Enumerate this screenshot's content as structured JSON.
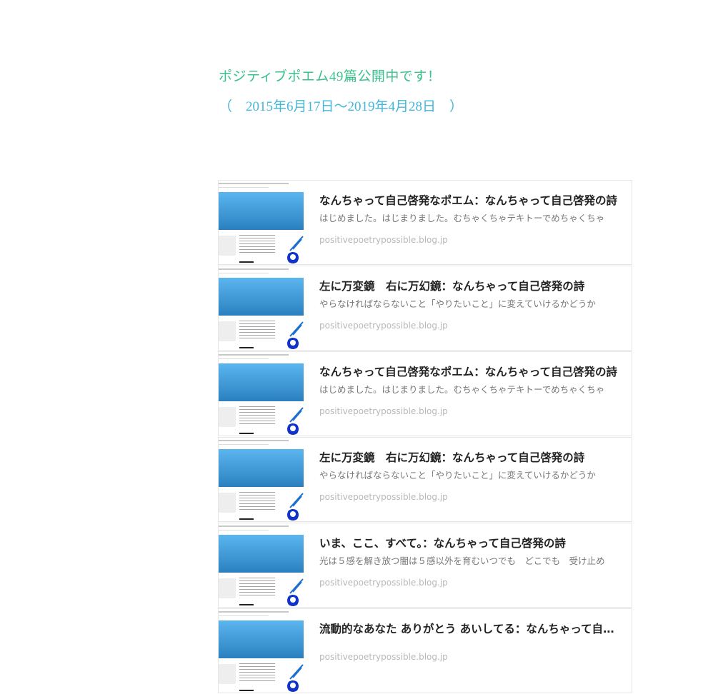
{
  "header": {
    "line1": "ポジティブポエム49篇公開中です！",
    "line2": "（　2015年6月17日～2019年4月28日　）"
  },
  "cards": [
    {
      "title": "なんちゃって自己啓発なポエム：なんちゃって自己啓発の詩",
      "excerpt": "はじめました。はじまりました。むちゃくちゃテキトーでめちゃくちゃ",
      "domain": "positivepoetrypossible.blog.jp"
    },
    {
      "title": "左に万変鏡　右に万幻鏡：なんちゃって自己啓発の詩",
      "excerpt": "やらなければならないこと「やりたいこと」に変えていけるかどうか",
      "domain": "positivepoetrypossible.blog.jp"
    },
    {
      "title": "なんちゃって自己啓発なポエム：なんちゃって自己啓発の詩",
      "excerpt": "はじめました。はじまりました。むちゃくちゃテキトーでめちゃくちゃ",
      "domain": "positivepoetrypossible.blog.jp"
    },
    {
      "title": "左に万変鏡　右に万幻鏡：なんちゃって自己啓発の詩",
      "excerpt": "やらなければならないこと「やりたいこと」に変えていけるかどうか",
      "domain": "positivepoetrypossible.blog.jp"
    },
    {
      "title": "いま、ここ、すべて。：なんちゃって自己啓発の詩",
      "excerpt": "光は５感を解き放つ闇は５感以外を育むいつでも　どこでも　受け止め",
      "domain": "positivepoetrypossible.blog.jp"
    },
    {
      "title": "流動的なあなた ありがとう あいしてる：なんちゃって自己啓発の詩",
      "excerpt": "",
      "domain": "positivepoetrypossible.blog.jp"
    }
  ]
}
